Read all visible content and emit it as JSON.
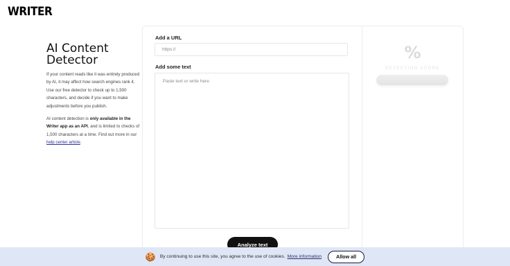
{
  "brand": {
    "logo_text": "WRITER"
  },
  "sidebar": {
    "title": "AI Content Detector",
    "para1": "If your content reads like it was entirely produced by AI, it may affect how search engines rank it. Use our free detector to check up to 1,500 characters, and decide if you want to make adjustments before you publish.",
    "para2_prefix": "AI content detection is ",
    "para2_bold": "only available in the Writer app as an API",
    "para2_mid": ", and is limited to checks of 1,500 characters at a time. Find out more in our ",
    "para2_link": "help center article",
    "para2_suffix": "."
  },
  "form": {
    "url_label": "Add a URL",
    "url_placeholder": "https://",
    "text_label": "Add some text",
    "text_placeholder": "Paste text or write here",
    "analyze_label": "Analyze text"
  },
  "score": {
    "symbol": "%",
    "label": "DETECTION SCORE"
  },
  "cookie": {
    "icon": "cookie-icon",
    "icon_glyph": "🍪",
    "text": "By continuing to use this site, you agree to the use of cookies.",
    "link": "More information",
    "allow_label": "Allow all"
  },
  "colors": {
    "cookie_bg": "#dfe6f5",
    "button_dark": "#111111",
    "link": "#2c2c9e"
  }
}
